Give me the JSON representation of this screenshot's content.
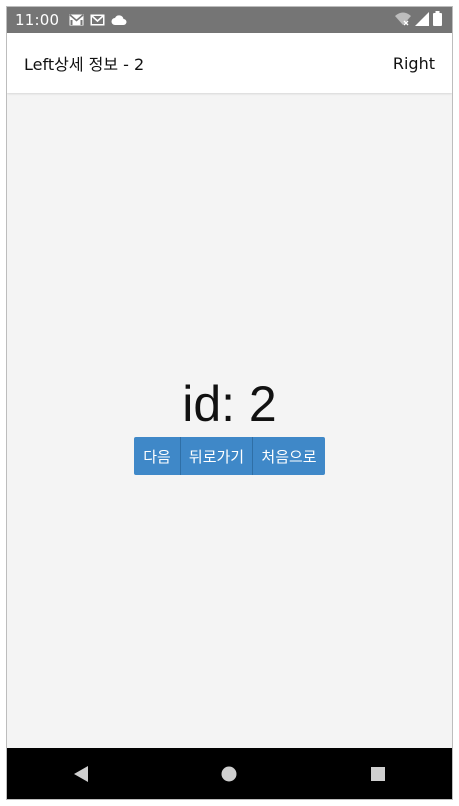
{
  "status_bar": {
    "time": "11:00",
    "notification_icons": [
      "mail-icon",
      "mail-icon",
      "cloud-icon"
    ],
    "system_icons": [
      "wifi-icon",
      "signal-icon",
      "battery-icon"
    ]
  },
  "app_bar": {
    "title": "Left상세 정보 - 2",
    "right_label": "Right"
  },
  "main": {
    "id_text": "id: 2",
    "buttons": {
      "next": "다음",
      "back": "뒤로가기",
      "first": "처음으로"
    }
  },
  "nav_bar": {
    "icons": [
      "back-triangle-icon",
      "home-circle-icon",
      "recents-square-icon"
    ]
  },
  "colors": {
    "status_bar": "#757575",
    "button": "#3f88c8",
    "background": "#f4f4f4",
    "nav_bar": "#000000"
  }
}
